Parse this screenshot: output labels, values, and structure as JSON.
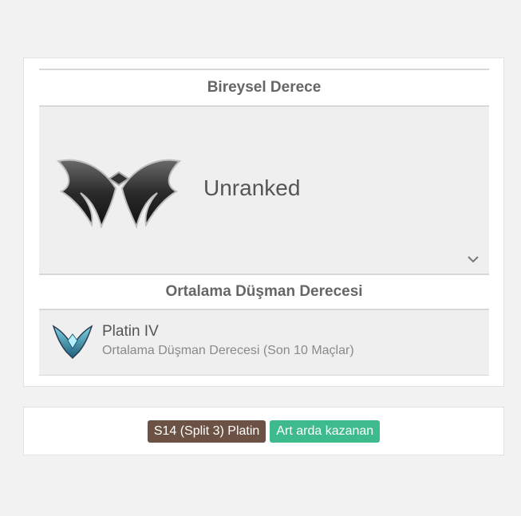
{
  "rank_card": {
    "solo_heading": "Bireysel Derece",
    "current_rank": "Unranked",
    "emblem_icon": "unranked-wings-emblem-icon",
    "expand_icon": "chevron-down-icon",
    "avg_heading": "Ortalama Düşman Derecesi",
    "avg_tier": "Platin IV",
    "avg_subtitle": "Ortalama Düşman Derecesi (Son 10 Maçlar)",
    "avg_icon": "platinum-emblem-icon"
  },
  "tags": [
    {
      "label": "S14 (Split 3) Platin",
      "color": "#6b5245"
    },
    {
      "label": "Art arda kazanan",
      "color": "#3dbb8c"
    }
  ]
}
